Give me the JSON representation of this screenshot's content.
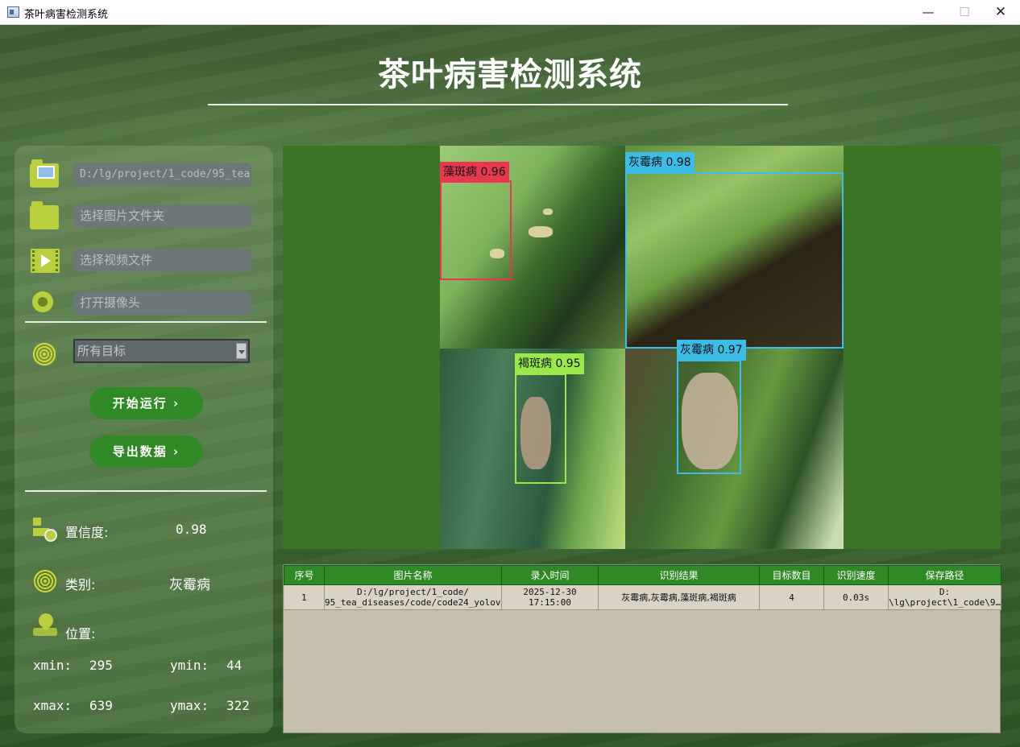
{
  "window": {
    "title": "茶叶病害检测系统",
    "min_glyph": "—",
    "max_glyph": "☐",
    "close_glyph": "✕"
  },
  "header": {
    "title": "茶叶病害检测系统"
  },
  "inputs": {
    "image_path": "D:/lg/project/1_code/95_tea",
    "folder_placeholder": "选择图片文件夹",
    "video_placeholder": "选择视频文件",
    "camera_placeholder": "打开摄像头"
  },
  "target_select": {
    "value": "所有目标"
  },
  "buttons": {
    "start": "开始运行 ›",
    "export": "导出数据 ›"
  },
  "info": {
    "confidence_label": "置信度:",
    "confidence_value": "0.98",
    "class_label": "类别:",
    "class_value": "灰霉病",
    "position_label": "位置:",
    "xmin_label": "xmin:",
    "xmin_value": "295",
    "ymin_label": "ymin:",
    "ymin_value": "44",
    "xmax_label": "xmax:",
    "xmax_value": "639",
    "ymax_label": "ymax:",
    "ymax_value": "322"
  },
  "detections": [
    {
      "label": "藻斑病 0.96",
      "color": "#e8384f"
    },
    {
      "label": "灰霉病 0.98",
      "color": "#3cbde8"
    },
    {
      "label": "褐斑病 0.95",
      "color": "#9be84a"
    },
    {
      "label": "灰霉病 0.97",
      "color": "#3cbde8"
    }
  ],
  "table": {
    "headers": [
      "序号",
      "图片名称",
      "录入时间",
      "识别结果",
      "目标数目",
      "识别速度",
      "保存路径"
    ],
    "rows": [
      {
        "index": "1",
        "name_line1": "D:/lg/project/1_code/",
        "name_line2": "95_tea_diseases/code/code24_yolov…",
        "date": "2025-12-30",
        "time": "17:15:00",
        "result": "灰霉病,灰霉病,藻斑病,褐斑病",
        "count": "4",
        "speed": "0.03s",
        "path_line1": "D:",
        "path_line2": "\\lg\\project\\1_code\\9…"
      }
    ]
  },
  "icons": [
    "app-icon",
    "image-folder-icon",
    "folder-icon",
    "video-file-icon",
    "camera-icon",
    "target-icon",
    "confidence-icon",
    "class-icon",
    "location-pin-icon"
  ]
}
